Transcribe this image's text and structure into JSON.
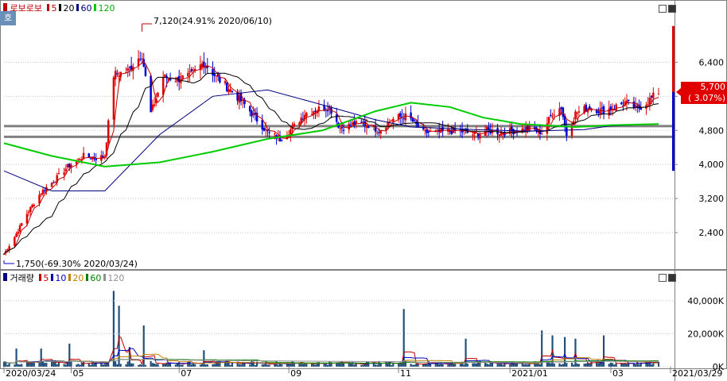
{
  "stock_name": "로보로보",
  "ho_badge": "호",
  "price_legend": [
    {
      "label": "5",
      "color": "#c00000"
    },
    {
      "label": "20",
      "color": "#000000"
    },
    {
      "label": "60",
      "color": "#000080"
    },
    {
      "label": "120",
      "color": "#00cc00"
    }
  ],
  "volume_title": "거래량",
  "volume_legend": [
    {
      "label": "5",
      "color": "#c00000"
    },
    {
      "label": "10",
      "color": "#0000c0"
    },
    {
      "label": "20",
      "color": "#c08000"
    },
    {
      "label": "60",
      "color": "#008000"
    },
    {
      "label": "120",
      "color": "#909090"
    }
  ],
  "annotations": {
    "high": "7,120(24.91% 2020/06/10)",
    "low": "1,750(-69.30% 2020/03/24)"
  },
  "current_price": {
    "price": "5,700",
    "change": "( 3.07%)"
  },
  "x_axis_labels": [
    "2020/03/24",
    "05",
    "07",
    "09",
    "11",
    "2021/01",
    "03",
    "2021/03/29"
  ],
  "price_y_ticks": [
    "6,400",
    "5,600",
    "4,800",
    "4,000",
    "3,200",
    "2,400"
  ],
  "volume_y_ticks": [
    "40,000K",
    "20,000K",
    "0K"
  ],
  "colors": {
    "up": "#e00000",
    "down": "#0000d0",
    "ma5": "#c00000",
    "ma20": "#000000",
    "ma60": "#000080",
    "ma120": "#00cc00"
  },
  "chart_data": [
    {
      "type": "candlestick",
      "title": "로보로보",
      "x_range": [
        "2020/03/24",
        "2021/03/29"
      ],
      "ylim": [
        1600,
        7600
      ],
      "y_ticks": [
        2400,
        3200,
        4000,
        4800,
        5600,
        6400
      ],
      "horizontal_lines": [
        4900,
        4650
      ],
      "high": {
        "value": 7120,
        "date": "2020/06/10",
        "change_pct": 24.91
      },
      "low": {
        "value": 1750,
        "date": "2020/03/24",
        "change_pct": -69.3
      },
      "last": {
        "value": 5700,
        "change_pct": 3.07
      },
      "anchor_points": [
        [
          "2020/03/24",
          1900
        ],
        [
          "2020/03/30",
          2300
        ],
        [
          "2020/04/06",
          2850
        ],
        [
          "2020/04/14",
          3350
        ],
        [
          "2020/04/22",
          3650
        ],
        [
          "2020/04/29",
          3950
        ],
        [
          "2020/05/08",
          4200
        ],
        [
          "2020/05/15",
          4150
        ],
        [
          "2020/05/20",
          4200
        ],
        [
          "2020/05/25",
          6100
        ],
        [
          "2020/06/02",
          6200
        ],
        [
          "2020/06/10",
          6600
        ],
        [
          "2020/06/15",
          5200
        ],
        [
          "2020/06/22",
          6050
        ],
        [
          "2020/06/30",
          6000
        ],
        [
          "2020/07/08",
          6100
        ],
        [
          "2020/07/15",
          6400
        ],
        [
          "2020/07/22",
          6050
        ],
        [
          "2020/07/30",
          5750
        ],
        [
          "2020/08/06",
          5450
        ],
        [
          "2020/08/13",
          5100
        ],
        [
          "2020/08/20",
          4750
        ],
        [
          "2020/08/27",
          4600
        ],
        [
          "2020/09/03",
          4850
        ],
        [
          "2020/09/10",
          5200
        ],
        [
          "2020/09/17",
          5300
        ],
        [
          "2020/09/24",
          5350
        ],
        [
          "2020/09/30",
          4850
        ],
        [
          "2020/10/08",
          4950
        ],
        [
          "2020/10/15",
          4950
        ],
        [
          "2020/10/22",
          4800
        ],
        [
          "2020/10/29",
          5050
        ],
        [
          "2020/11/05",
          5150
        ],
        [
          "2020/11/09",
          5050
        ],
        [
          "2020/11/16",
          4750
        ],
        [
          "2020/11/25",
          4750
        ],
        [
          "2020/12/05",
          4800
        ],
        [
          "2020/12/15",
          4700
        ],
        [
          "2020/12/22",
          4800
        ],
        [
          "2020/12/30",
          4750
        ],
        [
          "2021/01/08",
          4800
        ],
        [
          "2021/01/15",
          4850
        ],
        [
          "2021/01/22",
          4750
        ],
        [
          "2021/01/28",
          5200
        ],
        [
          "2021/02/02",
          5350
        ],
        [
          "2021/02/05",
          4700
        ],
        [
          "2021/02/10",
          5200
        ],
        [
          "2021/02/18",
          5350
        ],
        [
          "2021/02/25",
          5250
        ],
        [
          "2021/03/04",
          5350
        ],
        [
          "2021/03/10",
          5450
        ],
        [
          "2021/03/17",
          5300
        ],
        [
          "2021/03/22",
          5450
        ],
        [
          "2021/03/29",
          5700
        ]
      ],
      "ma120_points": [
        [
          "2020/03/24",
          4500
        ],
        [
          "2020/04/20",
          4200
        ],
        [
          "2020/05/20",
          3950
        ],
        [
          "2020/06/20",
          4050
        ],
        [
          "2020/07/20",
          4300
        ],
        [
          "2020/08/20",
          4600
        ],
        [
          "2020/09/20",
          4800
        ],
        [
          "2020/10/20",
          5250
        ],
        [
          "2020/11/09",
          5450
        ],
        [
          "2020/12/01",
          5350
        ],
        [
          "2020/12/20",
          5100
        ],
        [
          "2021/01/10",
          4950
        ],
        [
          "2021/02/10",
          4880
        ],
        [
          "2021/03/01",
          4920
        ],
        [
          "2021/03/29",
          4950
        ]
      ],
      "ma60_points": [
        [
          "2020/03/24",
          3850
        ],
        [
          "2020/04/20",
          3380
        ],
        [
          "2020/05/20",
          3380
        ],
        [
          "2020/06/20",
          4700
        ],
        [
          "2020/07/20",
          5600
        ],
        [
          "2020/08/20",
          5750
        ],
        [
          "2020/09/20",
          5400
        ],
        [
          "2020/10/20",
          5050
        ],
        [
          "2020/11/09",
          4880
        ],
        [
          "2020/12/15",
          4820
        ],
        [
          "2021/01/15",
          4780
        ],
        [
          "2021/02/15",
          4820
        ],
        [
          "2021/03/01",
          4900
        ],
        [
          "2021/03/29",
          4950
        ]
      ]
    },
    {
      "type": "bar",
      "title": "거래량",
      "units": "K",
      "ylim": [
        0,
        52000
      ],
      "y_ticks": [
        0,
        20000,
        40000
      ],
      "spikes": [
        [
          "2020/03/31",
          11000
        ],
        [
          "2020/04/14",
          11000
        ],
        [
          "2020/04/30",
          14000
        ],
        [
          "2020/05/25",
          46000
        ],
        [
          "2020/05/28",
          37000
        ],
        [
          "2020/06/03",
          12000
        ],
        [
          "2020/06/11",
          25000
        ],
        [
          "2020/07/15",
          10000
        ],
        [
          "2020/11/05",
          35000
        ],
        [
          "2020/12/10",
          17000
        ],
        [
          "2021/01/22",
          22000
        ],
        [
          "2021/01/28",
          19000
        ],
        [
          "2021/02/04",
          18000
        ],
        [
          "2021/02/10",
          17000
        ],
        [
          "2021/02/26",
          19000
        ]
      ]
    }
  ]
}
